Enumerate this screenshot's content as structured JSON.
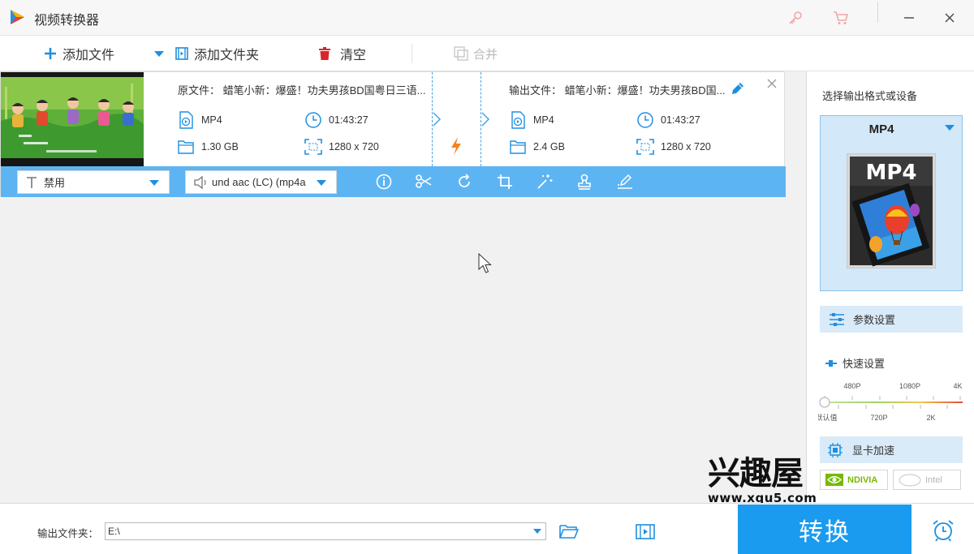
{
  "window": {
    "title": "视频转换器"
  },
  "toolbar": {
    "add_file": "添加文件",
    "add_folder": "添加文件夹",
    "clear": "清空",
    "merge": "合并"
  },
  "file": {
    "source_title": "原文件：  蜡笔小新：爆盛！功夫男孩BD国粤日三语...",
    "output_title": "输出文件：  蜡笔小新：爆盛！功夫男孩BD国...",
    "source": {
      "format": "MP4",
      "duration": "01:43:27",
      "size": "1.30 GB",
      "resolution": "1280 x 720"
    },
    "output": {
      "format": "MP4",
      "duration": "01:43:27",
      "size": "2.4 GB",
      "resolution": "1280 x 720"
    },
    "subtitle_select": "禁用",
    "audio_select": "und aac (LC) (mp4a"
  },
  "panel": {
    "title": "选择输出格式或设备",
    "format": "MP4",
    "format_badge": "MP4",
    "param_settings": "参数设置",
    "quick_settings": "快速设置",
    "slider_top_labels": [
      "480P",
      "1080P",
      "4K"
    ],
    "slider_bottom_labels": [
      "默认值",
      "720P",
      "2K"
    ],
    "gpu_accel": "显卡加速",
    "gpu_options": [
      "NDIVIA",
      "Intel"
    ]
  },
  "bottom": {
    "output_folder_label": "输出文件夹：",
    "output_folder_value": "E:\\",
    "convert": "转换"
  },
  "watermark": {
    "text": "兴趣屋",
    "url": "www.xqu5.com"
  },
  "colors": {
    "accent": "#1a9bf0",
    "bar": "#5db4f3",
    "clear_icon": "#d9252a",
    "lightning": "#f58220"
  }
}
